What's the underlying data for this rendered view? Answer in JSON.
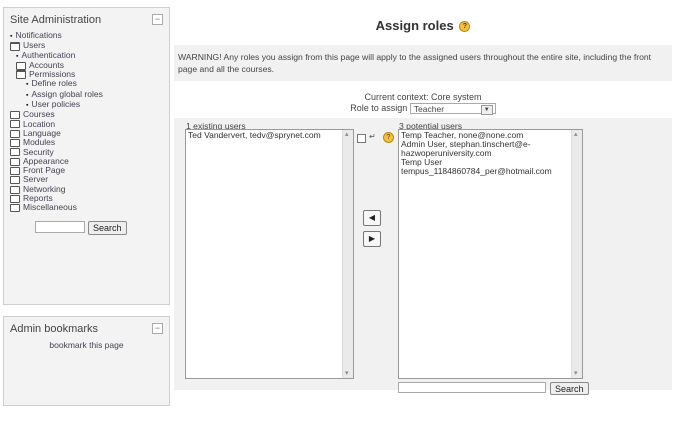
{
  "site_admin": {
    "title": "Site Administration",
    "collapse": "−",
    "items": [
      {
        "label": "Notifications",
        "type": "bullet",
        "level": 0
      },
      {
        "label": "Users",
        "type": "folder-open",
        "level": 0
      },
      {
        "label": "Authentication",
        "type": "bullet",
        "level": 1
      },
      {
        "label": "Accounts",
        "type": "folder",
        "level": 1
      },
      {
        "label": "Permissions",
        "type": "folder-open",
        "level": 1
      },
      {
        "label": "Define roles",
        "type": "bullet",
        "level": 2
      },
      {
        "label": "Assign global roles",
        "type": "bullet",
        "level": 2
      },
      {
        "label": "User policies",
        "type": "bullet",
        "level": 2
      },
      {
        "label": "Courses",
        "type": "folder",
        "level": 0
      },
      {
        "label": "Location",
        "type": "folder",
        "level": 0
      },
      {
        "label": "Language",
        "type": "folder",
        "level": 0
      },
      {
        "label": "Modules",
        "type": "folder",
        "level": 0
      },
      {
        "label": "Security",
        "type": "folder",
        "level": 0
      },
      {
        "label": "Appearance",
        "type": "folder",
        "level": 0
      },
      {
        "label": "Front Page",
        "type": "folder",
        "level": 0
      },
      {
        "label": "Server",
        "type": "folder",
        "level": 0
      },
      {
        "label": "Networking",
        "type": "folder",
        "level": 0
      },
      {
        "label": "Reports",
        "type": "folder",
        "level": 0
      },
      {
        "label": "Miscellaneous",
        "type": "folder",
        "level": 0
      }
    ],
    "search_button": "Search"
  },
  "bookmarks": {
    "title": "Admin bookmarks",
    "collapse": "−",
    "link": "bookmark this page"
  },
  "main": {
    "title": "Assign roles",
    "help": "?",
    "warning": "WARNING! Any roles you assign from this page will apply to the assigned users throughout the entire site, including the front page and all the courses.",
    "context": "Current context: Core system",
    "role_label": "Role to assign",
    "role_value": "Teacher",
    "existing_label": "1 existing users",
    "existing_users": [
      "Ted Vandervert, tedv@sprynet.com"
    ],
    "potential_label": "3 potential users",
    "potential_users": [
      "Temp Teacher, none@none.com",
      "Admin User, stephan.tinschert@e-hazwoperuniversity.com",
      "Temp User tempus_1184860784_per@hotmail.com"
    ],
    "add_arrow": "◀",
    "remove_arrow": "▶",
    "search_button": "Search"
  }
}
